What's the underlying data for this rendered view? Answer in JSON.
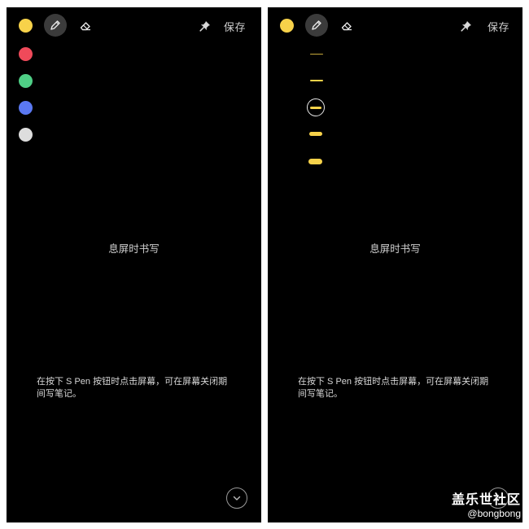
{
  "screens": [
    {
      "id": "left",
      "toolbar": {
        "save_label": "保存",
        "selected_color": "#f7d24a"
      },
      "palette": [
        "#ef4a5a",
        "#4fcf86",
        "#5b79f2",
        "#dddddd"
      ],
      "title": "息屏时书写",
      "hint": "在按下 S Pen 按钮时点击屏幕，可在屏幕关闭期间写笔记。"
    },
    {
      "id": "right",
      "toolbar": {
        "save_label": "保存",
        "selected_color": "#f7d24a"
      },
      "pen_thickness_levels": [
        1,
        2,
        3,
        4,
        5
      ],
      "selected_thickness": 3,
      "title": "息屏时书写",
      "hint": "在按下 S Pen 按钮时点击屏幕，可在屏幕关闭期间写笔记。"
    }
  ],
  "watermark": {
    "title": "盖乐世社区",
    "handle": "@bongbong"
  }
}
